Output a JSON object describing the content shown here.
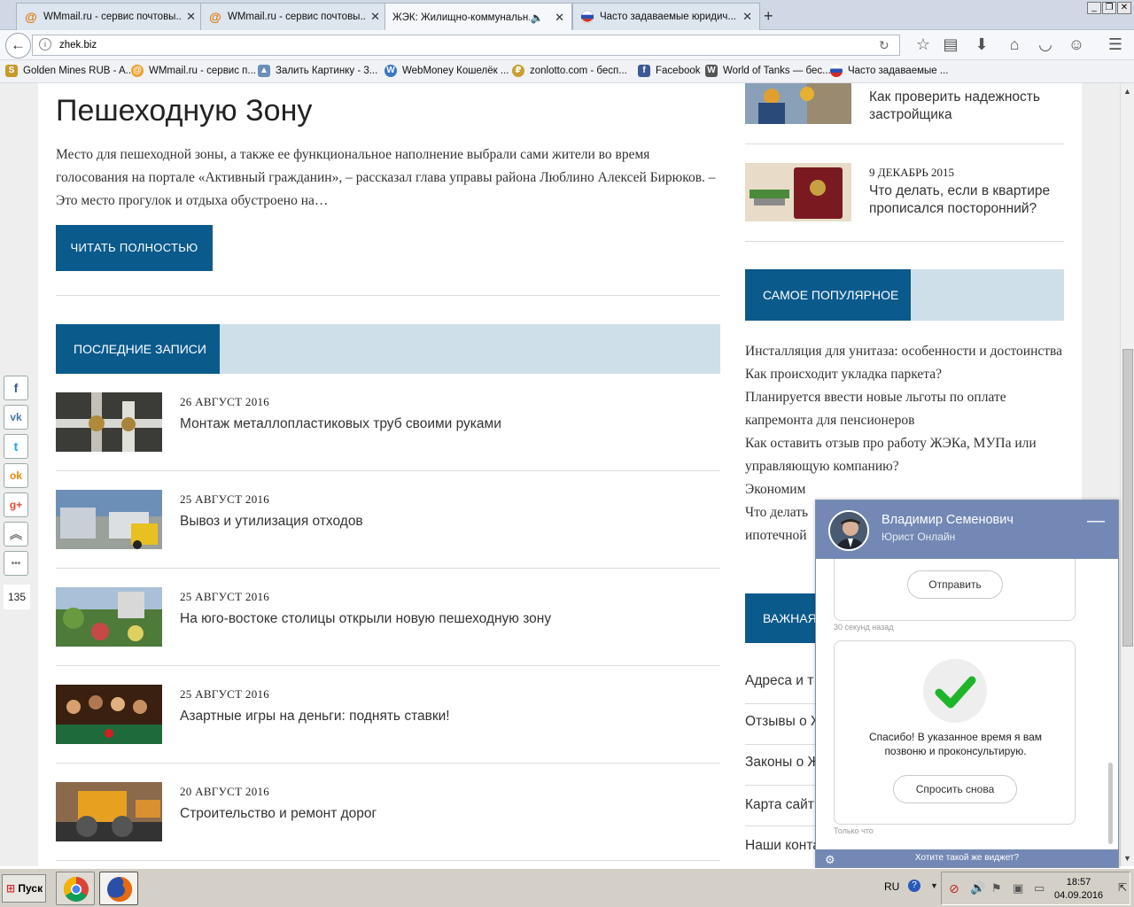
{
  "browser": {
    "tabs": [
      {
        "title": "WMmail.ru - сервис почтовы...",
        "icon": "at-sign-icon",
        "active": false
      },
      {
        "title": "WMmail.ru - сервис почтовы...",
        "icon": "at-sign-icon",
        "active": false
      },
      {
        "title": "ЖЭК: Жилищно-коммунальн...",
        "icon": "speaker-icon",
        "active": true
      },
      {
        "title": "Часто задаваемые юридич...",
        "icon": "flag-icon",
        "active": false
      }
    ],
    "new_tab": "+",
    "url": "zhek.biz",
    "window_buttons": [
      "_",
      "❐",
      "✕"
    ],
    "bookmarks": [
      {
        "label": "Golden Mines RUB - A...",
        "color": "#c79a2c"
      },
      {
        "label": "WMmail.ru - сервис п...",
        "color": "#f0a030"
      },
      {
        "label": "Залить Картинку - 3...",
        "color": "#6a8fb8"
      },
      {
        "label": "WebMoney Кошелёк ...",
        "color": "#3a78c3"
      },
      {
        "label": "zonlotto.com - бесп...",
        "color": "#c8a030"
      },
      {
        "label": "Facebook",
        "color": "#3b5998"
      },
      {
        "label": "World of Tanks — бес...",
        "color": "#555555"
      },
      {
        "label": "Часто задаваемые ...",
        "color": "#d03030"
      }
    ]
  },
  "article": {
    "headline": "Пешеходную Зону",
    "excerpt": "Место для пешеходной зоны, а также ее функциональное наполнение выбрали сами жители во время голосования на портале «Активный гражданин», – рассказал глава управы района Люблино Алексей Бирюков. – Это место прогулок и отдыха обустроено на…",
    "read_more": "ЧИТАТЬ ПОЛНОСТЬЮ"
  },
  "latest": {
    "heading": "ПОСЛЕДНИЕ ЗАПИСИ",
    "posts": [
      {
        "date": "26 АВГУСТ 2016",
        "title": "Монтаж металлопластиковых труб своими руками"
      },
      {
        "date": "25 АВГУСТ 2016",
        "title": "Вывоз и утилизация отходов"
      },
      {
        "date": "25 АВГУСТ 2016",
        "title": "На юго-востоке столицы открыли новую пешеходную зону"
      },
      {
        "date": "25 АВГУСТ 2016",
        "title": "Азартные игры на деньги: поднять ставки!"
      },
      {
        "date": "20 АВГУСТ 2016",
        "title": "Строительство и ремонт дорог"
      }
    ]
  },
  "sidebar": {
    "posts": [
      {
        "date": "",
        "title": "Как проверить надежность застройщика"
      },
      {
        "date": "9 ДЕКАБРЬ 2015",
        "title": "Что делать, если в квартире прописался посторонний?"
      }
    ],
    "popular_heading": "САМОЕ ПОПУЛЯРНОЕ",
    "popular": [
      "Инсталляция для унитаза: особенности и достоинства",
      "Как происходит укладка паркета?",
      "Планируется ввести новые льготы по оплате капремонта для пенсионеров",
      "Как оставить отзыв про работу ЖЭКа, МУПа или управляющую компанию?",
      "Экономим",
      "Что делать",
      "ипотечной"
    ],
    "important_heading": "ВАЖНАЯ",
    "links": [
      "Адреса и т",
      "Отзывы о Ж",
      "Законы о Ж",
      "Карта сайт",
      "Наши конта"
    ]
  },
  "social": {
    "buttons": [
      {
        "name": "facebook",
        "glyph": "f",
        "color": "#3b5998"
      },
      {
        "name": "vkontakte",
        "glyph": "vk",
        "color": "#4c75a3"
      },
      {
        "name": "twitter",
        "glyph": "t",
        "color": "#1da1f2"
      },
      {
        "name": "odnoklassniki",
        "glyph": "ok",
        "color": "#ee8208"
      },
      {
        "name": "google-plus",
        "glyph": "g+",
        "color": "#dd4b39"
      },
      {
        "name": "scroll-up",
        "glyph": "︽",
        "color": "#777777"
      },
      {
        "name": "more",
        "glyph": "•••",
        "color": "#777777"
      }
    ],
    "count": "135"
  },
  "chat": {
    "name": "Владимир Семенович",
    "role": "Юрист Онлайн",
    "minimize": "—",
    "send_label": "Отправить",
    "stamp1": "30 секунд назад",
    "thanks": "Спасибо! В указанное время я вам позвоню и проконсультирую.",
    "ask_again": "Спросить снова",
    "stamp2": "Только что",
    "footer": "Хотите такой же виджет?"
  },
  "taskbar": {
    "start": "Пуск",
    "lang": "RU",
    "time": "18:57",
    "date": "04.09.2016"
  }
}
